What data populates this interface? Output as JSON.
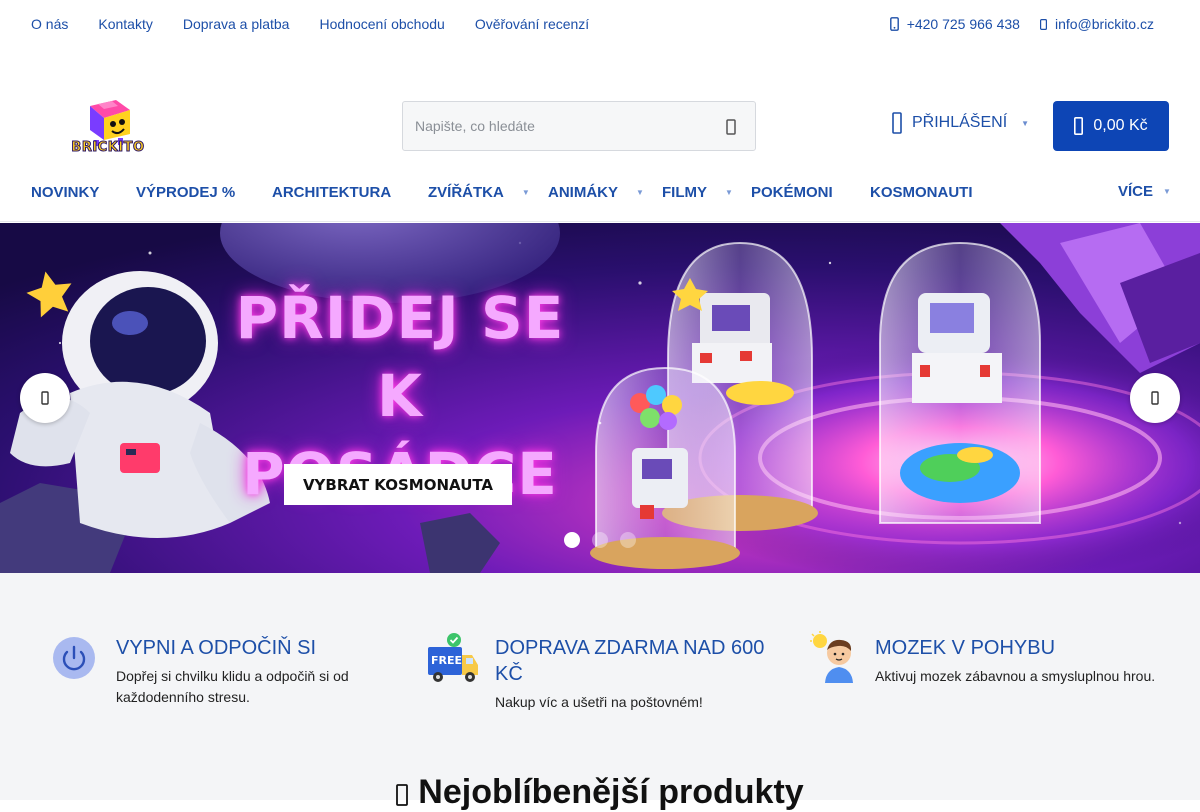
{
  "topbar": {
    "links": [
      "O nás",
      "Kontakty",
      "Doprava a platba",
      "Hodnocení obchodu",
      "Ověřování recenzí"
    ],
    "phone": "+420 725 966 438",
    "email": "info@brickito.cz"
  },
  "header": {
    "logo_text": "BRICKITO",
    "search_placeholder": "Napište, co hledáte",
    "login_label": "PŘIHLÁŠENÍ",
    "cart_total": "0,00 Kč"
  },
  "nav": {
    "items": [
      "NOVINKY",
      "VÝPRODEJ %",
      "ARCHITEKTURA",
      "ZVÍŘÁTKA",
      "ANIMÁKY",
      "FILMY",
      "POKÉMONI",
      "KOSMONAUTI"
    ],
    "more_label": "VÍCE"
  },
  "hero": {
    "title_line1": "PŘIDEJ SE",
    "title_line2": "K POSÁDCE",
    "cta": "VYBRAT KOSMONAUTA",
    "slide_count": 3,
    "active_slide": 1
  },
  "benefits": [
    {
      "title": "VYPNI A ODPOČIŇ SI",
      "text": "Dopřej si chvilku klidu a odpočiň si od každodenního stresu.",
      "icon": "power-icon"
    },
    {
      "title": "DOPRAVA ZDARMA NAD 600 KČ",
      "text": "Nakup víc a ušetři na poštovném!",
      "icon": "free-delivery-truck-icon",
      "badge": "FREE"
    },
    {
      "title": "MOZEK V POHYBU",
      "text": "Aktivuj mozek zábavnou a smysluplnou hrou.",
      "icon": "thinking-kid-icon"
    }
  ],
  "section": {
    "title": "Nejoblíbenější produkty"
  },
  "colors": {
    "primary": "#1d4fa8",
    "cart_bg": "#0d45b5",
    "benefits_bg": "#f4f5f7"
  }
}
